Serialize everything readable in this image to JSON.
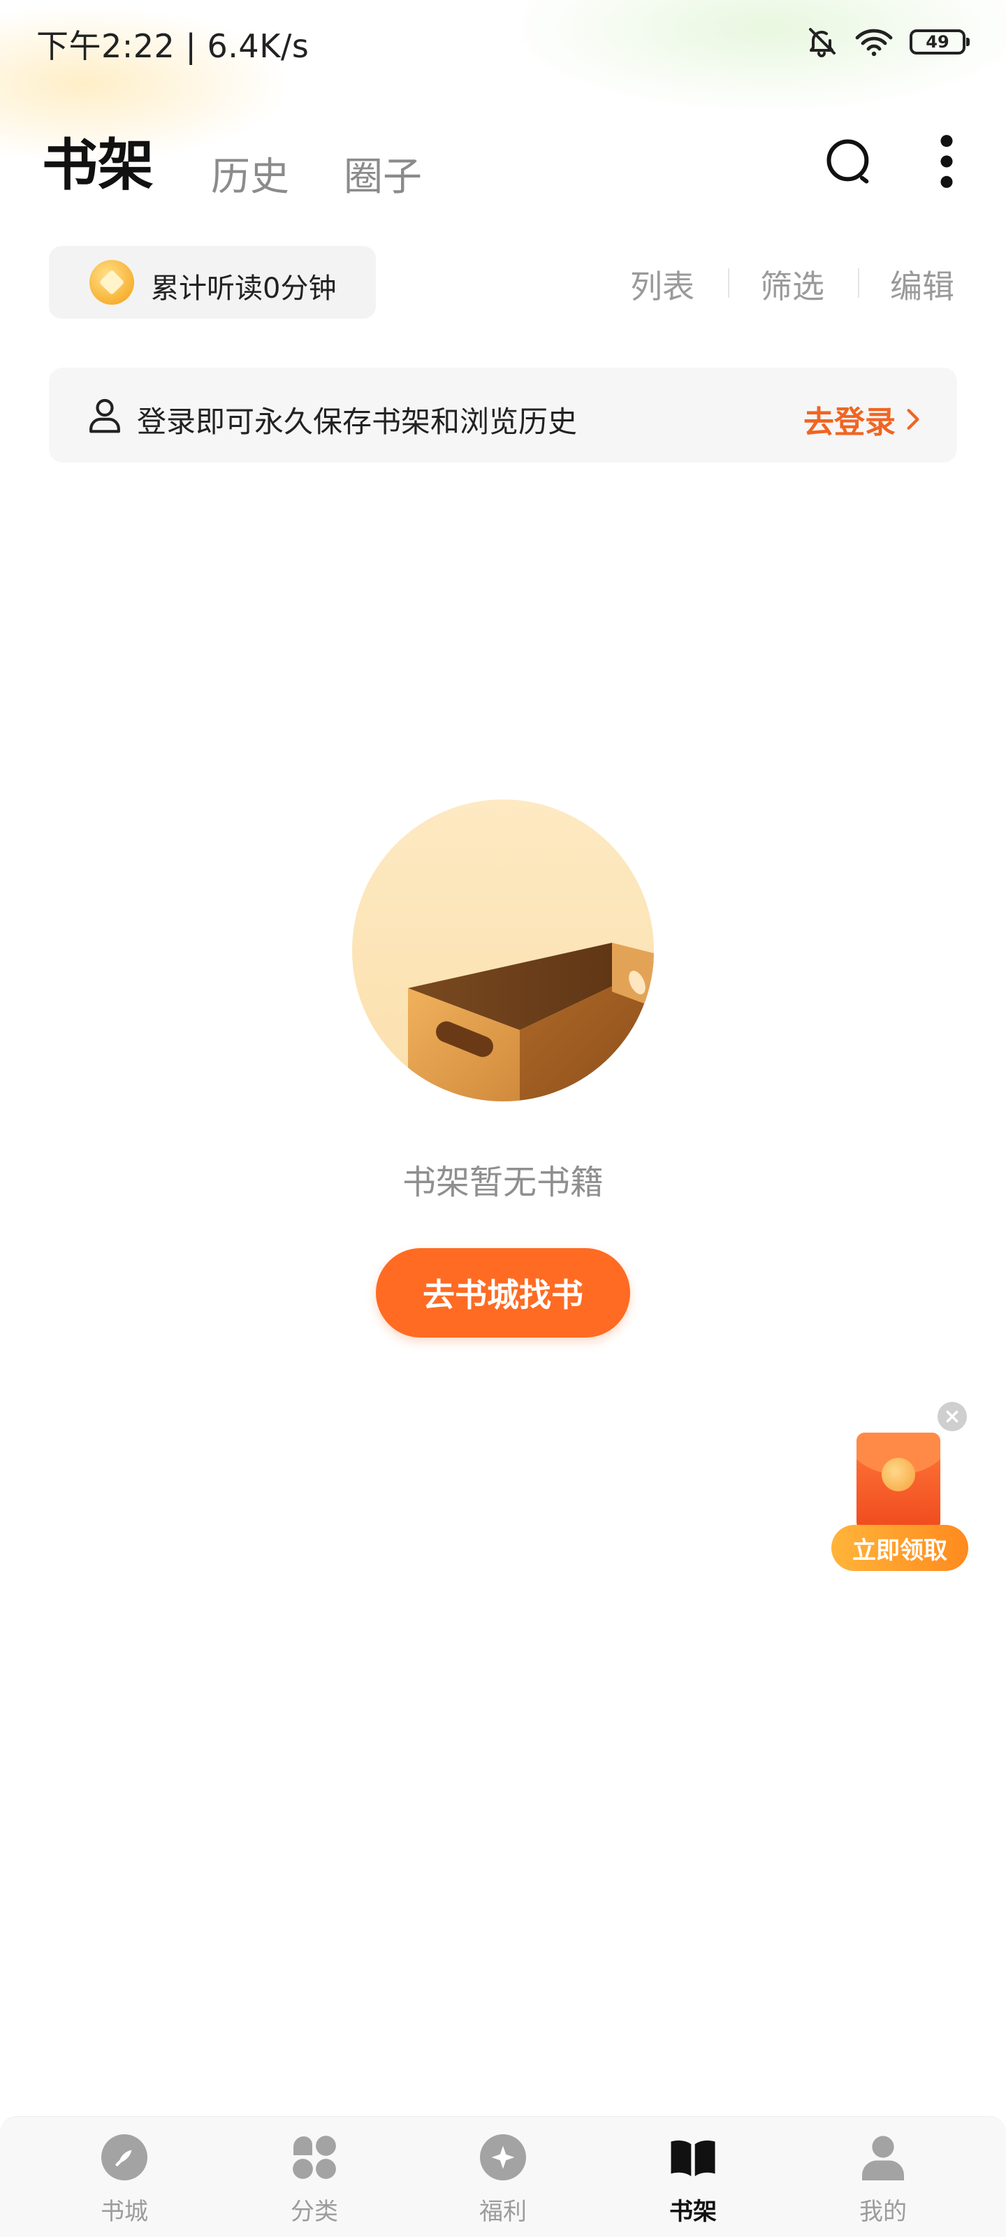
{
  "status_bar": {
    "time_speed": "下午2:22 | 6.4K/s",
    "battery": "49",
    "icons": [
      "bell-off-icon",
      "wifi-icon",
      "battery-icon"
    ]
  },
  "header": {
    "tabs": [
      {
        "label": "书架",
        "active": true
      },
      {
        "label": "历史",
        "active": false
      },
      {
        "label": "圈子",
        "active": false
      }
    ],
    "icons": [
      "search-icon",
      "more-vertical-icon"
    ]
  },
  "toolbar": {
    "reading_time": "累计听读0分钟",
    "list": "列表",
    "filter": "筛选",
    "edit": "编辑"
  },
  "login_banner": {
    "text": "登录即可永久保存书架和浏览历史",
    "link": "去登录"
  },
  "empty_state": {
    "message": "书架暂无书籍",
    "button": "去书城找书"
  },
  "floating_packet": {
    "label": "立即领取"
  },
  "bottom_nav": {
    "items": [
      {
        "label": "书城",
        "icon": "compass-icon"
      },
      {
        "label": "分类",
        "icon": "category-icon"
      },
      {
        "label": "福利",
        "icon": "welfare-icon"
      },
      {
        "label": "书架",
        "icon": "bookshelf-icon",
        "active": true
      },
      {
        "label": "我的",
        "icon": "profile-icon"
      }
    ]
  },
  "colors": {
    "accent": "#ff6b22",
    "link": "#f06522",
    "muted": "#9a9a9a"
  }
}
